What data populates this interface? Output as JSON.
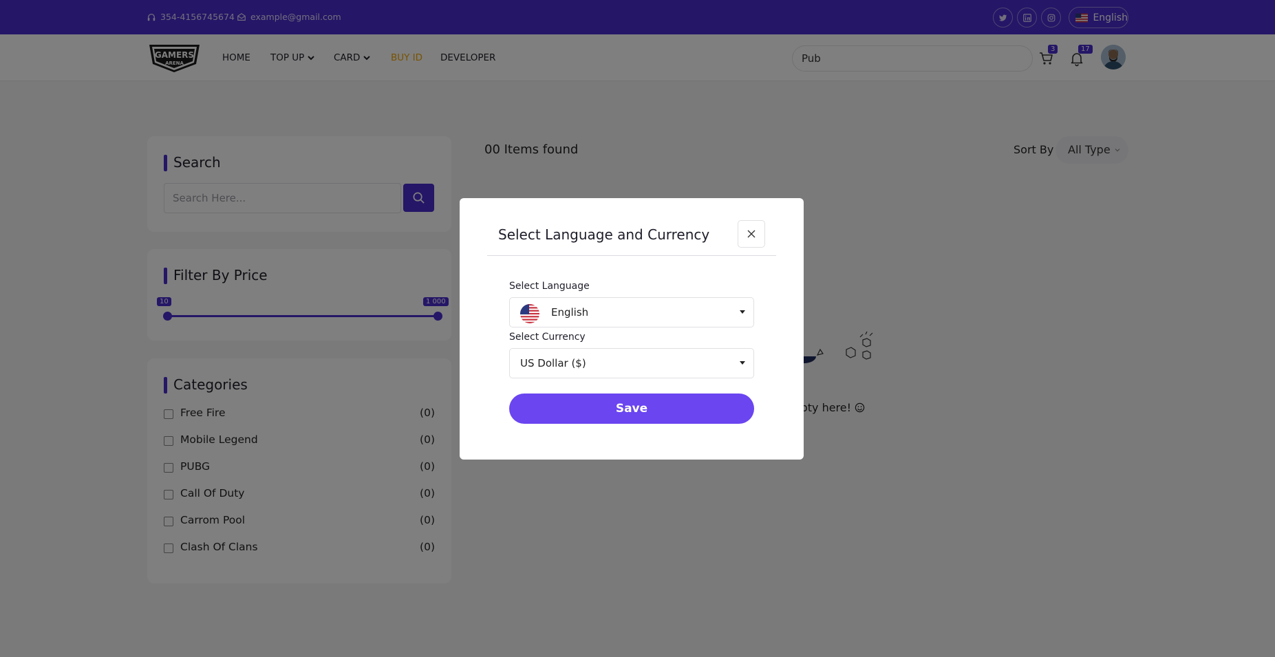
{
  "topbar": {
    "phone": "354-4156745674",
    "email": "example@gmail.com",
    "social": [
      "twitter-icon",
      "linkedin-icon",
      "instagram-icon"
    ],
    "language": "English"
  },
  "navbar": {
    "logo_text_top": "GAMERS",
    "logo_text_bottom": "ARENA",
    "items": [
      {
        "label": "HOME",
        "dropdown": false,
        "active": false
      },
      {
        "label": "TOP UP",
        "dropdown": true,
        "active": false
      },
      {
        "label": "CARD",
        "dropdown": true,
        "active": false
      },
      {
        "label": "BUY ID",
        "dropdown": false,
        "active": true
      },
      {
        "label": "DEVELOPER",
        "dropdown": false,
        "active": false
      }
    ],
    "search_value": "Pub",
    "cart_count": "3",
    "notification_count": "17"
  },
  "sidebar": {
    "search": {
      "title": "Search",
      "placeholder": "Search Here..."
    },
    "price": {
      "title": "Filter By Price",
      "min": "10",
      "max": "1 000"
    },
    "categories": {
      "title": "Categories",
      "items": [
        {
          "label": "Free Fire",
          "count": "(0)"
        },
        {
          "label": "Mobile Legend",
          "count": "(0)"
        },
        {
          "label": "PUBG",
          "count": "(0)"
        },
        {
          "label": "Call Of Duty",
          "count": "(0)"
        },
        {
          "label": "Carrom Pool",
          "count": "(0)"
        },
        {
          "label": "Clash Of Clans",
          "count": "(0)"
        }
      ]
    }
  },
  "main": {
    "items_found": "00 Items found",
    "sort_label": "Sort By",
    "sort_value": "All Type",
    "empty_text": "mpty here!"
  },
  "modal": {
    "title": "Select Language and Currency",
    "language_label": "Select Language",
    "language_value": "English",
    "currency_label": "Select Currency",
    "currency_value": "US Dollar ($)",
    "save_label": "Save"
  },
  "colors": {
    "brand": "#4b2ccf",
    "save_button": "#6a45f0",
    "active_nav": "#f0a500"
  }
}
